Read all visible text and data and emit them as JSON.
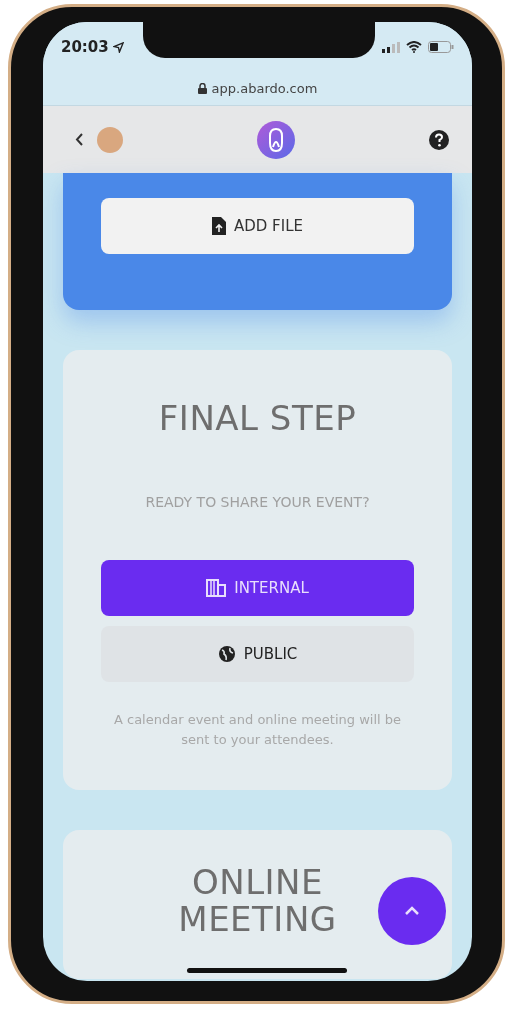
{
  "status_bar": {
    "time": "20:03"
  },
  "url_bar": {
    "url": "app.abardo.com"
  },
  "upload_card": {
    "button": "ADD FILE"
  },
  "final_step": {
    "title": "FINAL STEP",
    "subtitle": "READY TO SHARE YOUR EVENT?",
    "options": [
      {
        "label": "INTERNAL",
        "selected": true,
        "kind": "internal"
      },
      {
        "label": "PUBLIC",
        "selected": false,
        "kind": "public"
      }
    ],
    "note": "A calendar event and online meeting will be sent to your attendees."
  },
  "online_meeting": {
    "title": "ONLINE MEETING"
  }
}
